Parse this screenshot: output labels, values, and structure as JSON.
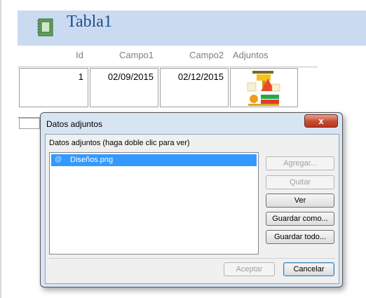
{
  "form": {
    "title": "Tabla1",
    "columns": [
      "Id",
      "Campo1",
      "Campo2",
      "Adjuntos"
    ],
    "record": {
      "id": "1",
      "campo1": "02/09/2015",
      "campo2": "02/12/2015"
    }
  },
  "dialog": {
    "title": "Datos adjuntos",
    "close_symbol": "x",
    "list_label": "Datos adjuntos (haga doble clic para ver)",
    "files": [
      "Diseños.png"
    ],
    "buttons": {
      "agregar": "Agregar...",
      "quitar": "Quitar",
      "ver": "Ver",
      "guardar_como": "Guardar como...",
      "guardar_todo": "Guardar todo...",
      "aceptar": "Aceptar",
      "cancelar": "Cancelar"
    }
  },
  "colors": {
    "header_band": "#c9daf1",
    "title_text": "#1f4e8c",
    "selection": "#3399ff",
    "close_button": "#c74a2f"
  },
  "icons": [
    "table-icon",
    "attachment-thumbnail",
    "paperclip-icon",
    "close-icon"
  ]
}
